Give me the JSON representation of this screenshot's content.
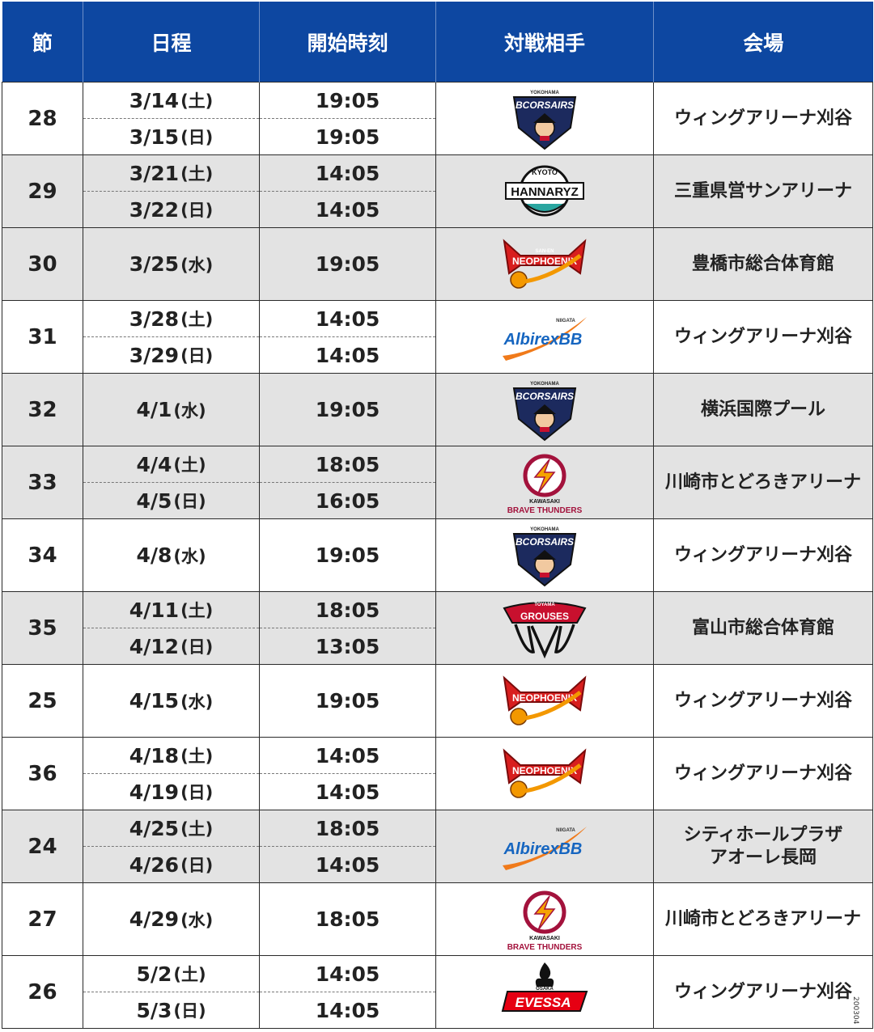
{
  "header": {
    "setsu": "節",
    "date": "日程",
    "time": "開始時刻",
    "opponent": "対戦相手",
    "venue": "会場"
  },
  "rows": [
    {
      "setsu": "28",
      "highlight": false,
      "shade": "white",
      "dates": [
        {
          "date": "3/14",
          "weekday": "(土)"
        },
        {
          "date": "3/15",
          "weekday": "(日)"
        }
      ],
      "times": [
        "19:05",
        "19:05"
      ],
      "logo": "corsairs",
      "venue": "ウィングアリーナ刈谷"
    },
    {
      "setsu": "29",
      "highlight": false,
      "shade": "gray",
      "dates": [
        {
          "date": "3/21",
          "weekday": "(土)"
        },
        {
          "date": "3/22",
          "weekday": "(日)"
        }
      ],
      "times": [
        "14:05",
        "14:05"
      ],
      "logo": "hannaryz",
      "venue": "三重県営サンアリーナ"
    },
    {
      "setsu": "30",
      "highlight": false,
      "shade": "gray",
      "dates": [
        {
          "date": "3/25",
          "weekday": "(水)"
        }
      ],
      "times": [
        "19:05"
      ],
      "logo": "neophoenix",
      "venue": "豊橋市総合体育館"
    },
    {
      "setsu": "31",
      "highlight": false,
      "shade": "white",
      "dates": [
        {
          "date": "3/28",
          "weekday": "(土)"
        },
        {
          "date": "3/29",
          "weekday": "(日)"
        }
      ],
      "times": [
        "14:05",
        "14:05"
      ],
      "logo": "albirex",
      "venue": "ウィングアリーナ刈谷"
    },
    {
      "setsu": "32",
      "highlight": false,
      "shade": "gray",
      "dates": [
        {
          "date": "4/1",
          "weekday": "(水)"
        }
      ],
      "times": [
        "19:05"
      ],
      "logo": "corsairs",
      "venue": "横浜国際プール"
    },
    {
      "setsu": "33",
      "highlight": false,
      "shade": "gray",
      "dates": [
        {
          "date": "4/4",
          "weekday": "(土)"
        },
        {
          "date": "4/5",
          "weekday": "(日)"
        }
      ],
      "times": [
        "18:05",
        "16:05"
      ],
      "logo": "thunders",
      "venue": "川崎市とどろきアリーナ"
    },
    {
      "setsu": "34",
      "highlight": false,
      "shade": "white",
      "dates": [
        {
          "date": "4/8",
          "weekday": "(水)"
        }
      ],
      "times": [
        "19:05"
      ],
      "logo": "corsairs",
      "venue": "ウィングアリーナ刈谷"
    },
    {
      "setsu": "35",
      "highlight": false,
      "shade": "gray",
      "dates": [
        {
          "date": "4/11",
          "weekday": "(土)"
        },
        {
          "date": "4/12",
          "weekday": "(日)"
        }
      ],
      "times": [
        "18:05",
        "13:05"
      ],
      "logo": "grouses",
      "venue": "富山市総合体育館"
    },
    {
      "setsu": "25",
      "highlight": true,
      "shade": "white",
      "dates": [
        {
          "date": "4/15",
          "weekday": "(水)"
        }
      ],
      "times": [
        "19:05"
      ],
      "logo": "neophoenix",
      "venue": "ウィングアリーナ刈谷"
    },
    {
      "setsu": "36",
      "highlight": false,
      "shade": "white",
      "dates": [
        {
          "date": "4/18",
          "weekday": "(土)"
        },
        {
          "date": "4/19",
          "weekday": "(日)"
        }
      ],
      "times": [
        "14:05",
        "14:05"
      ],
      "logo": "neophoenix",
      "venue": "ウィングアリーナ刈谷"
    },
    {
      "setsu": "24",
      "highlight": true,
      "shade": "gray",
      "dates": [
        {
          "date": "4/25",
          "weekday": "(土)"
        },
        {
          "date": "4/26",
          "weekday": "(日)"
        }
      ],
      "times": [
        "18:05",
        "14:05"
      ],
      "logo": "albirex",
      "venue": "シティホールプラザ\nアオーレ長岡"
    },
    {
      "setsu": "27",
      "highlight": true,
      "shade": "white",
      "dates": [
        {
          "date": "4/29",
          "weekday": "(水)"
        }
      ],
      "times": [
        "18:05"
      ],
      "logo": "thunders",
      "venue": "川崎市とどろきアリーナ"
    },
    {
      "setsu": "26",
      "highlight": true,
      "shade": "white",
      "dates": [
        {
          "date": "5/2",
          "weekday": "(土)"
        },
        {
          "date": "5/3",
          "weekday": "(日)"
        }
      ],
      "times": [
        "14:05",
        "14:05"
      ],
      "logo": "evessa",
      "venue": "ウィングアリーナ刈谷"
    }
  ],
  "logos": {
    "corsairs": {
      "name": "corsairs-logo-icon",
      "top_text": "YOKOHAMA",
      "main_text": "BCORSAIRS",
      "color": "#1c2a5e",
      "accent": "#c8102e"
    },
    "hannaryz": {
      "name": "hannaryz-logo-icon",
      "top_text": "KYOTO",
      "main_text": "HANNARYZ",
      "color": "#111111",
      "accent": "#2aa6a0"
    },
    "neophoenix": {
      "name": "neophoenix-logo-icon",
      "top_text": "SAN-EN",
      "main_text": "NEOPHOENIX",
      "color": "#d81e1e",
      "accent": "#f39800"
    },
    "albirex": {
      "name": "albirex-logo-icon",
      "top_text": "NIIGATA",
      "main_text": "AlbirexBB",
      "color": "#1565c0",
      "accent": "#f07a1a"
    },
    "thunders": {
      "name": "thunders-logo-icon",
      "top_text": "KAWASAKI",
      "main_text": "BRAVE THUNDERS",
      "color": "#a3123c",
      "accent": "#f5a300"
    },
    "grouses": {
      "name": "grouses-logo-icon",
      "top_text": "TOYAMA",
      "main_text": "GROUSES",
      "color": "#c8102e",
      "accent": "#111111"
    },
    "evessa": {
      "name": "evessa-logo-icon",
      "top_text": "OSAKA",
      "main_text": "EVESSA",
      "color": "#e60012",
      "accent": "#111111"
    }
  },
  "colors": {
    "header_bg": "#0d47a1",
    "highlight_text": "#e8141b",
    "row_gray": "#e3e3e3"
  },
  "doc_code": "200304"
}
